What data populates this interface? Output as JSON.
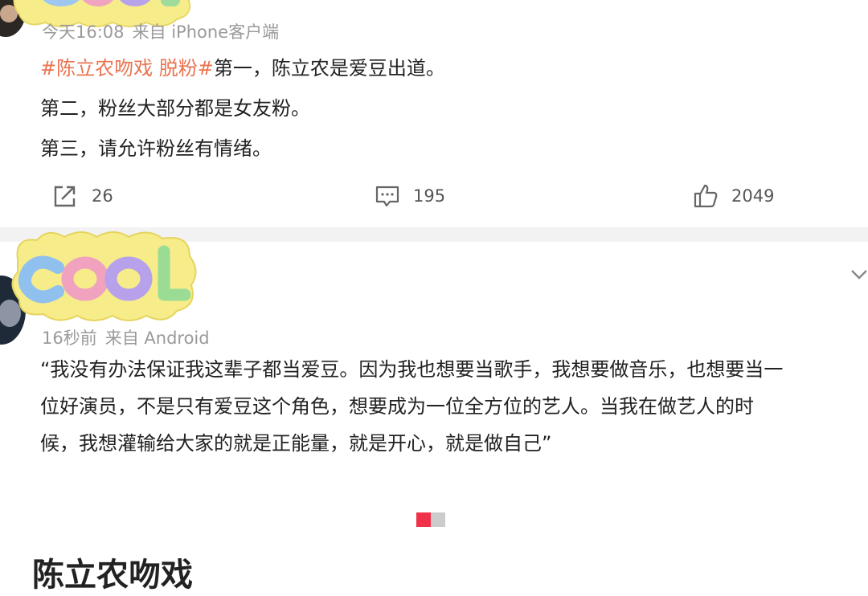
{
  "post1": {
    "badge_text": "COOL",
    "time": "今天16:08",
    "source": "来自 iPhone客户端",
    "hashtag": "#陈立农吻戏 脱粉#",
    "line1_rest": "第一，陈立农是爱豆出道。",
    "line2": "第二，粉丝大部分都是女友粉。",
    "line3": "第三，请允许粉丝有情绪。",
    "actions": {
      "share_count": "26",
      "comment_count": "195",
      "like_count": "2049"
    }
  },
  "post2": {
    "badge_text": "COOL",
    "time": "16秒前",
    "source": "来自 Android",
    "lines": [
      "“我没有办法保证我这辈子都当爱豆。因为我也想要当歌手，我想要做音乐，也想要当一",
      "位好演员，不是只有爱豆这个角色，想要成为一位全方位的艺人。当我在做艺人的时",
      "候，我想灌输给大家的就是正能量，就是开心，就是做自己”"
    ]
  },
  "page_indicator": {
    "current": 1,
    "total": 2,
    "active_color": "#f0314a",
    "inactive_color": "#cccccc"
  },
  "bottom_title": "陈立农吻戏",
  "colors": {
    "hashtag": "#eb7350",
    "meta": "#9a9a9a",
    "divider": "#f2f2f2"
  }
}
